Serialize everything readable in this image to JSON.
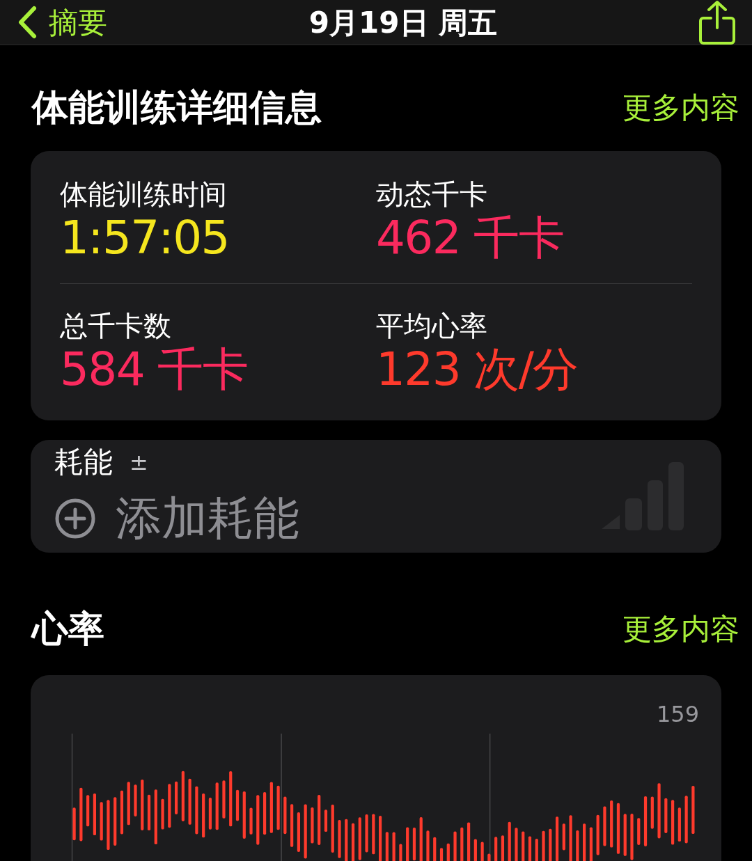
{
  "nav": {
    "back_label": "摘要",
    "title": "9月19日 周五"
  },
  "workout": {
    "title": "体能训练详细信息",
    "more_label": "更多内容",
    "metrics": [
      {
        "label": "体能训练时间",
        "value": "1:57:05",
        "color": "#f5e61e"
      },
      {
        "label": "动态千卡",
        "value": "462 千卡",
        "color": "#fb2a5e"
      },
      {
        "label": "总千卡数",
        "value": "584 千卡",
        "color": "#fb2a5e"
      },
      {
        "label": "平均心率",
        "value": "123 次/分",
        "color": "#fe3a2c"
      }
    ]
  },
  "effort": {
    "label": "耗能",
    "symbol": "±",
    "add_label": "添加耗能"
  },
  "heart_rate": {
    "title": "心率",
    "more_label": "更多内容",
    "max_label": "159"
  }
}
